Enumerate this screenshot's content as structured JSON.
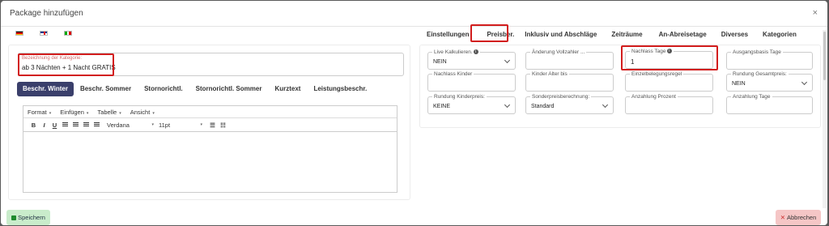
{
  "modal": {
    "title": "Package hinzufügen",
    "close_label": "×"
  },
  "languages": [
    "de-flag-icon",
    "gb-flag-icon",
    "it-flag-icon"
  ],
  "category": {
    "label": "Bezeichnung der Kategorie:",
    "value": "ab 3 Nächten + 1 Nacht GRATIS"
  },
  "left_tabs": [
    {
      "label": "Beschr. Winter",
      "active": true
    },
    {
      "label": "Beschr. Sommer"
    },
    {
      "label": "Stornorichtl."
    },
    {
      "label": "Stornorichtl. Sommer"
    },
    {
      "label": "Kurztext"
    },
    {
      "label": "Leistungsbeschr."
    }
  ],
  "editor": {
    "menu": [
      "Format",
      "Einfügen",
      "Tabelle",
      "Ansicht"
    ],
    "font": "Verdana",
    "size": "11pt",
    "tools": {
      "bold": "B",
      "italic": "I",
      "underline": "U"
    }
  },
  "right_tabs": [
    {
      "label": "Einstellungen"
    },
    {
      "label": "Preisber.",
      "active": true
    },
    {
      "label": "Inklusiv und Abschläge"
    },
    {
      "label": "Zeiträume"
    },
    {
      "label": "An-Abreisetage"
    },
    {
      "label": "Diverses"
    },
    {
      "label": "Kategorien"
    }
  ],
  "fields": {
    "live_kalk": {
      "label": "Live Kalkulieren.",
      "value": "NEIN"
    },
    "aenderung": {
      "label": "Änderung Vollzahler ...",
      "value": ""
    },
    "nachlass_tage": {
      "label": "Nachlass Tage",
      "value": "1"
    },
    "ausgangsbasis": {
      "label": "Ausgangsbasis Tage",
      "value": ""
    },
    "nachlass_kinder": {
      "label": "Nachlass Kinder",
      "value": ""
    },
    "kinder_alter": {
      "label": "Kinder Alter bis",
      "value": ""
    },
    "einzelbelegung": {
      "label": "Einzelbelegungsregel",
      "value": ""
    },
    "rundung_gesamt": {
      "label": "Rundung Gesamtpreis:",
      "value": "NEIN"
    },
    "rundung_kinder": {
      "label": "Rundung Kinderpreis:",
      "value": "KEINE"
    },
    "sonderpreis": {
      "label": "Sonderpreisberechnung:",
      "value": "Standard"
    },
    "anzahlung_prozent": {
      "label": "Anzahlung Prozent",
      "value": ""
    },
    "anzahlung_tage": {
      "label": "Anzahlung Tage",
      "value": ""
    }
  },
  "buttons": {
    "save": "Speichern",
    "cancel": "Abbrechen"
  },
  "colors": {
    "accent_tab": "#3a3f6b",
    "highlight": "#d21d1d",
    "save_bg": "#c9eccb",
    "cancel_bg": "#f5c6c6"
  }
}
